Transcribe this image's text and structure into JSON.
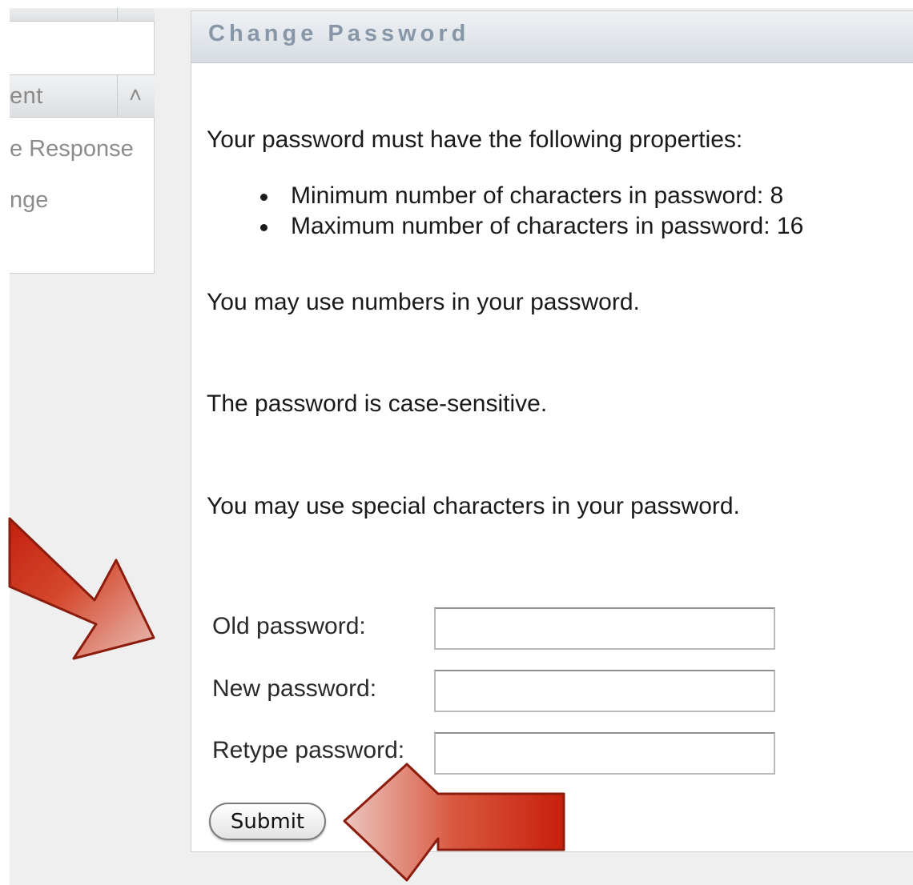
{
  "sidebar": {
    "header_title": "ent",
    "links": [
      "e Response",
      "nge"
    ]
  },
  "panel": {
    "title": "Change Password",
    "intro": "Your password must have the following properties:",
    "rules": [
      "Minimum number of characters in password: 8",
      "Maximum number of characters in password: 16"
    ],
    "notes": [
      "You may use numbers in your password.",
      "The password is case-sensitive.",
      "You may use special characters in your password."
    ]
  },
  "form": {
    "old_label": "Old password:",
    "new_label": "New password:",
    "retype_label": "Retype password:",
    "old_value": "",
    "new_value": "",
    "retype_value": "",
    "submit_label": "Submit"
  },
  "colors": {
    "panel_title": "#8797a8",
    "arrow_red": "#d23a1e",
    "arrow_outline": "#8b1c0e"
  },
  "icons": {
    "collapse": "double-chevron-up-icon",
    "annotation": "red-arrow-icon"
  }
}
